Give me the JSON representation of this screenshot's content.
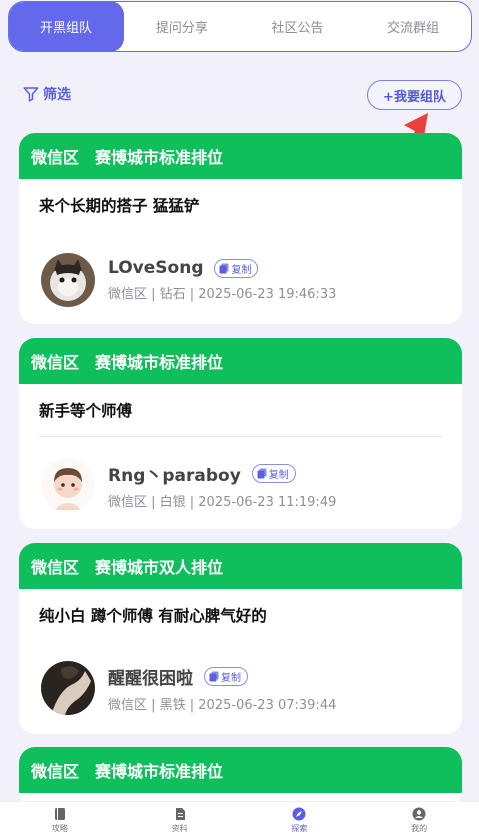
{
  "tabs": [
    "开黑组队",
    "提问分享",
    "社区公告",
    "交流群组"
  ],
  "filter_label": "筛选",
  "team_button": "+我要组队",
  "copy_label": "复制",
  "cards": [
    {
      "region": "微信区",
      "mode": "赛博城市标准排位",
      "title": "来个长期的搭子 猛猛铲",
      "username": "LOveSong",
      "meta": "微信区 | 钻石 | 2025-06-23 19:46:33"
    },
    {
      "region": "微信区",
      "mode": "赛博城市标准排位",
      "title": "新手等个师傅",
      "username": "Rng丶paraboy",
      "meta": "微信区 | 白银 | 2025-06-23 11:19:49"
    },
    {
      "region": "微信区",
      "mode": "赛博城市双人排位",
      "title": "纯小白 蹲个师傅 有耐心脾气好的",
      "username": "醒醒很困啦",
      "meta": "微信区 | 黑铁 | 2025-06-23 07:39:44"
    },
    {
      "region": "微信区",
      "mode": "赛博城市标准排位"
    }
  ],
  "nav": [
    "攻略",
    "资料",
    "探索",
    "我的"
  ],
  "colors": {
    "accent": "#6468ea",
    "card_header": "#0fbf5b",
    "arrow": "#e8403a"
  }
}
